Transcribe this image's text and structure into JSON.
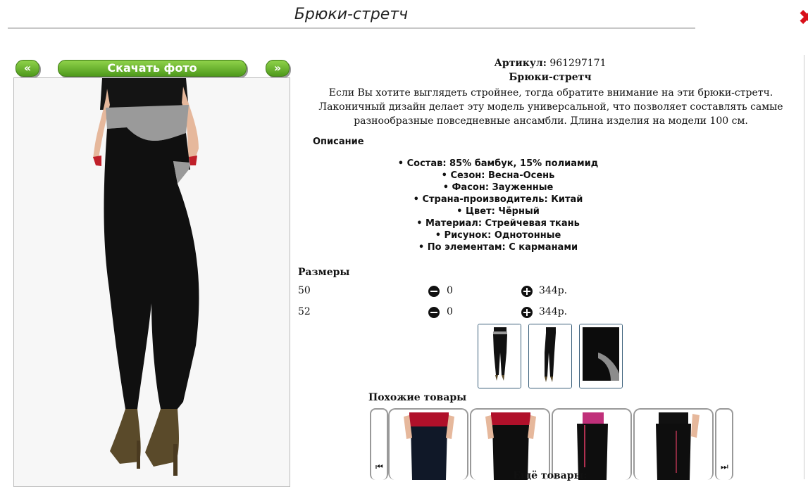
{
  "page": {
    "title": "Брюки-стретч"
  },
  "nav": {
    "prev_label": "«",
    "download_label": "Скачать фото",
    "next_label": "»"
  },
  "product": {
    "article_label": "Артикул:",
    "article_value": "961297171",
    "name": "Брюки-стретч",
    "description": "Если Вы хотите выглядеть стройнее, тогда обратите внимание на эти брюки-стретч. Лаконичный дизайн делает эту модель универсальной, что позволяет составлять самые разнообразные повседневные ансамбли. Длина изделия на модели 100 см.",
    "description_heading": "Описание",
    "properties": [
      "Состав: 85% бамбук, 15% полиамид",
      "Сезон: Весна-Осень",
      "Фасон: Зауженные",
      "Страна-производитель: Китай",
      "Цвет: Чёрный",
      "Материал: Стрейчевая ткань",
      "Рисунок: Однотонные",
      "По элементам: С карманами"
    ]
  },
  "sizes": {
    "heading": "Размеры",
    "rows": [
      {
        "size": "50",
        "qty": "0",
        "price": "344р."
      },
      {
        "size": "52",
        "qty": "0",
        "price": "344р."
      }
    ]
  },
  "similar": {
    "heading": "Похожие товары"
  },
  "more": {
    "heading": "Ещё товары:"
  },
  "icons": {
    "close": "close-icon",
    "minus": "minus-circle-icon",
    "plus": "plus-circle-icon",
    "carousel_prev": "skip-back-icon",
    "carousel_next": "skip-forward-icon"
  },
  "colors": {
    "button_green": "#5fa826",
    "close_red": "#d8101a",
    "thumb_border": "#3a5f7a"
  }
}
